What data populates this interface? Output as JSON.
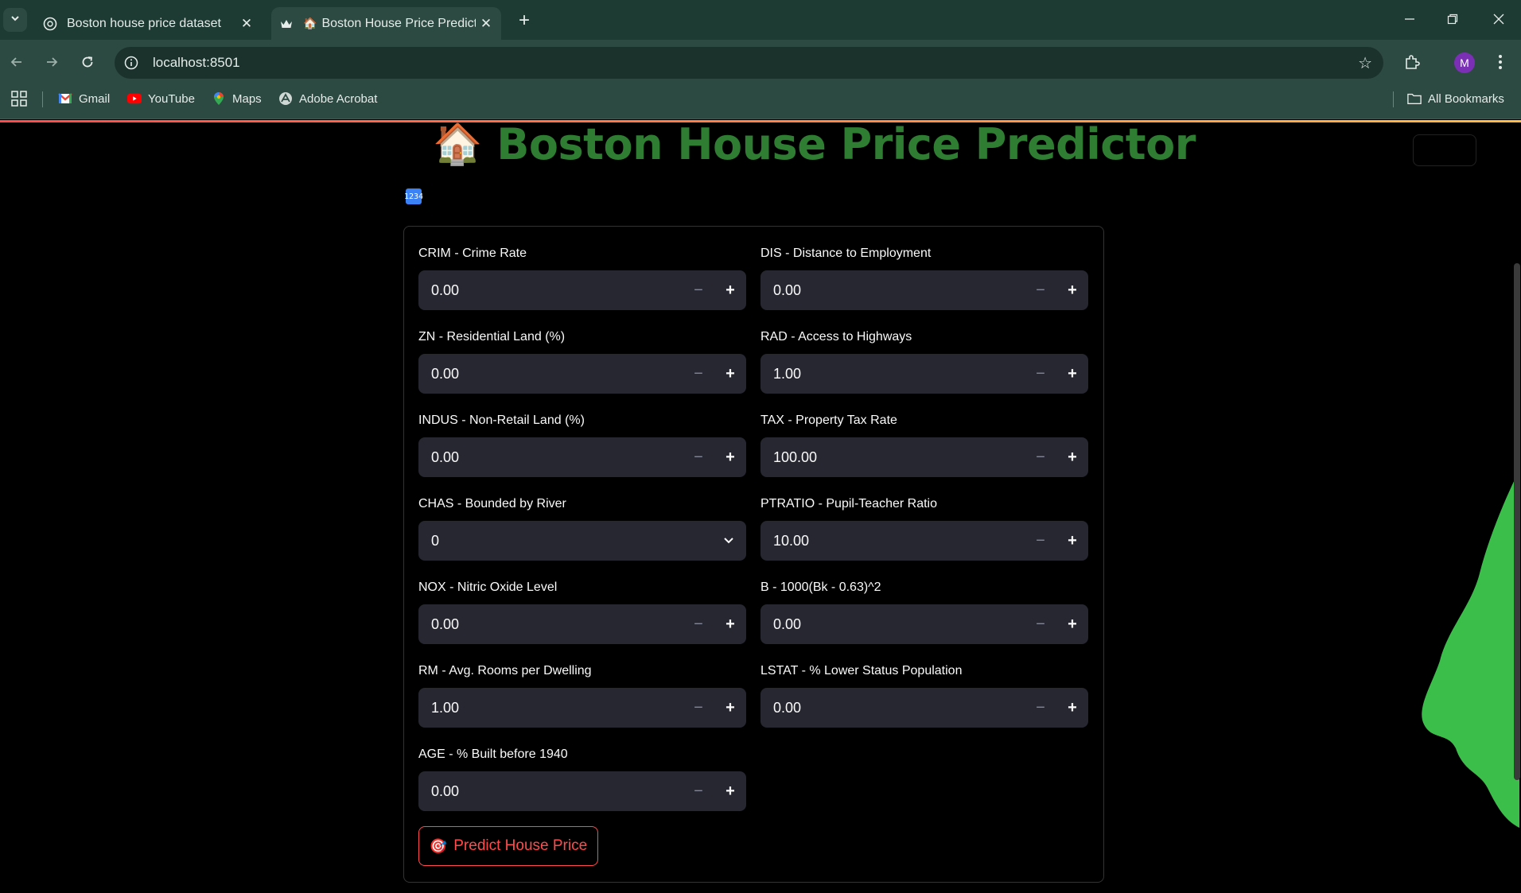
{
  "browser": {
    "tabs": [
      {
        "title": "Boston house price dataset",
        "favicon": "openai-icon",
        "active": false
      },
      {
        "title": "Boston House Price Predicto",
        "favicon": "house-emoji",
        "active": true
      }
    ],
    "url": "localhost:8501",
    "profile_initial": "M",
    "bookmarks": [
      {
        "label": "Gmail",
        "icon": "gmail-icon"
      },
      {
        "label": "YouTube",
        "icon": "youtube-icon"
      },
      {
        "label": "Maps",
        "icon": "maps-icon"
      },
      {
        "label": "Adobe Acrobat",
        "icon": "acrobat-icon"
      }
    ],
    "all_bookmarks": "All Bookmarks"
  },
  "app": {
    "title_emoji": "🏠",
    "title": "Boston House Price Predictor",
    "subheader_icon": "1234",
    "predict_emoji": "🎯",
    "predict_label": "Predict House Price",
    "accent_color": "#ff4b4b",
    "title_color": "#2e7d32"
  },
  "left_fields": [
    {
      "label": "CRIM - Crime Rate",
      "value": "0.00",
      "type": "number"
    },
    {
      "label": "ZN - Residential Land (%)",
      "value": "0.00",
      "type": "number"
    },
    {
      "label": "INDUS - Non-Retail Land (%)",
      "value": "0.00",
      "type": "number"
    },
    {
      "label": "CHAS - Bounded by River",
      "value": "0",
      "type": "select"
    },
    {
      "label": "NOX - Nitric Oxide Level",
      "value": "0.00",
      "type": "number"
    },
    {
      "label": "RM - Avg. Rooms per Dwelling",
      "value": "1.00",
      "type": "number"
    },
    {
      "label": "AGE - % Built before 1940",
      "value": "0.00",
      "type": "number"
    }
  ],
  "right_fields": [
    {
      "label": "DIS - Distance to Employment",
      "value": "0.00",
      "type": "number"
    },
    {
      "label": "RAD - Access to Highways",
      "value": "1.00",
      "type": "number"
    },
    {
      "label": "TAX - Property Tax Rate",
      "value": "100.00",
      "type": "number"
    },
    {
      "label": "PTRATIO - Pupil-Teacher Ratio",
      "value": "10.00",
      "type": "number"
    },
    {
      "label": "B - 1000(Bk - 0.63)^2",
      "value": "0.00",
      "type": "number"
    },
    {
      "label": "LSTAT - % Lower Status Population",
      "value": "0.00",
      "type": "number"
    }
  ]
}
